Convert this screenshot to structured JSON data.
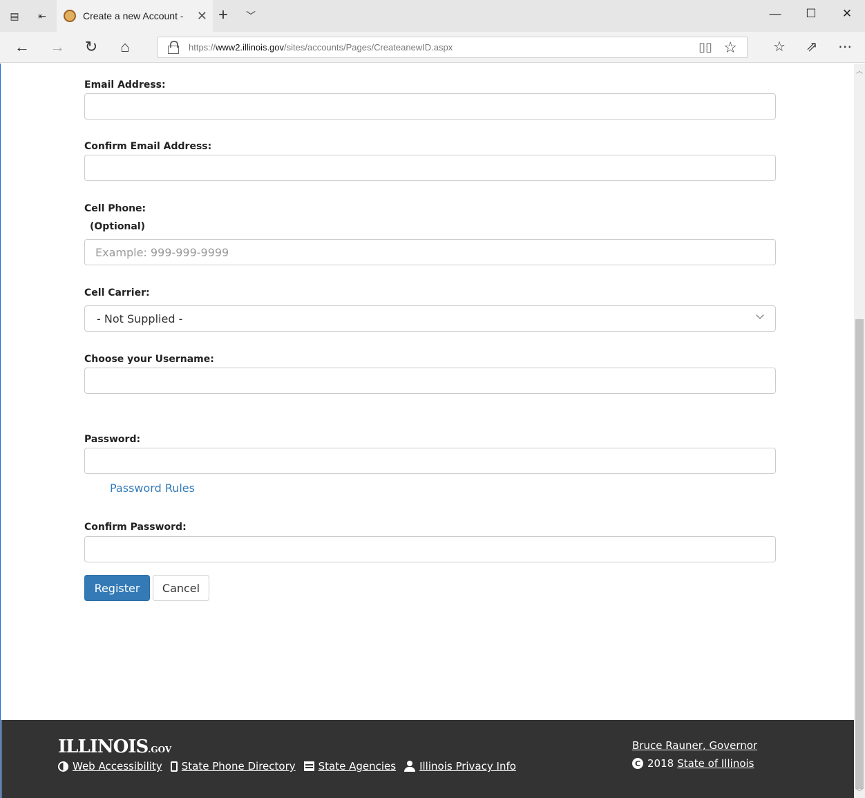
{
  "browser": {
    "tab_title": "Create a new Account -",
    "url_scheme": "https://",
    "url_domain": "www2.illinois.gov",
    "url_path": "/sites/accounts/Pages/CreateanewID.aspx"
  },
  "form": {
    "email_label": "Email Address:",
    "confirm_email_label": "Confirm Email Address:",
    "cell_phone_label": "Cell Phone:",
    "cell_phone_optional": "(Optional)",
    "cell_phone_placeholder": "Example: 999-999-9999",
    "cell_carrier_label": "Cell Carrier:",
    "cell_carrier_selected": "- Not Supplied -",
    "username_label": "Choose your Username:",
    "password_label": "Password:",
    "password_rules_link": "Password Rules",
    "confirm_password_label": "Confirm Password:",
    "register_button": "Register",
    "cancel_button": "Cancel"
  },
  "footer": {
    "logo_main": "ILLINOIS",
    "logo_suffix": ".GOV",
    "links": [
      "Web Accessibility",
      "State Phone Directory",
      "State Agencies",
      "Illinois Privacy Info"
    ],
    "governor": "Bruce Rauner, Governor",
    "copyright_year": "2018",
    "state_link": "State of Illinois"
  },
  "colors": {
    "primary": "#337ab7",
    "footer_bg": "#333333",
    "link": "#337ab7"
  }
}
